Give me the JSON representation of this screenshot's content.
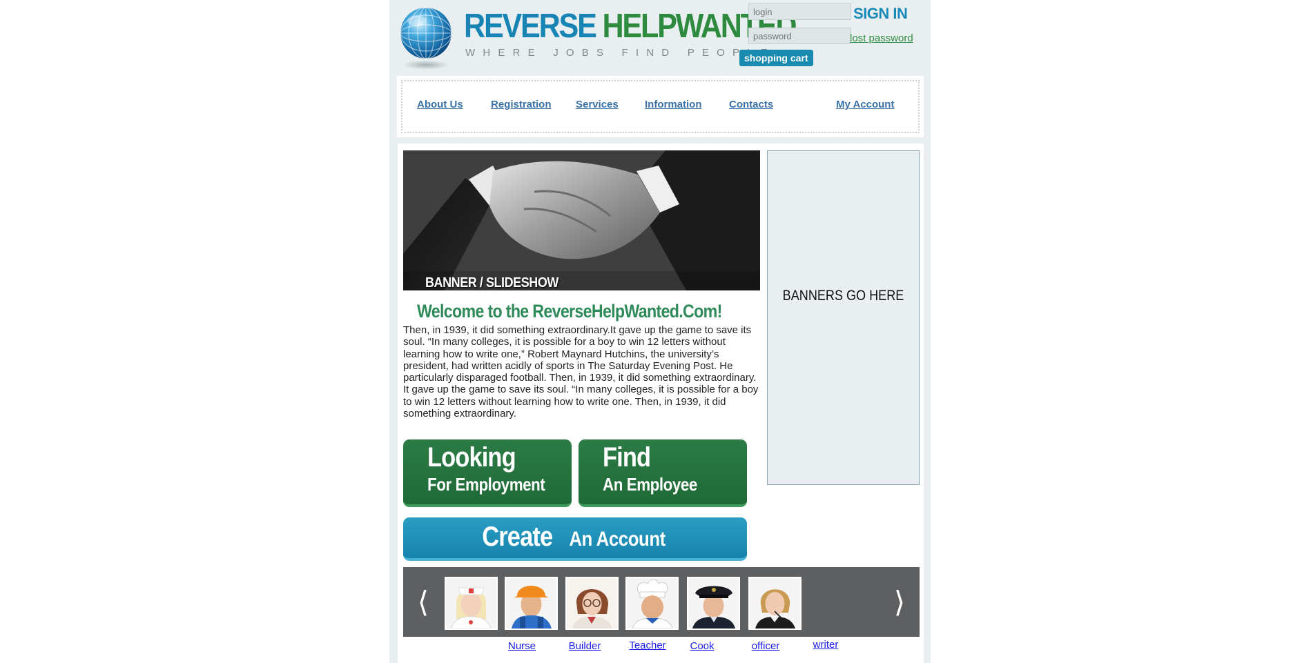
{
  "header": {
    "logo_word1": "REVERSE",
    "logo_word2": "HELPWANTED",
    "tagline": "WHERE JOBS FIND PEOPLE",
    "login_placeholder": "login",
    "password_placeholder": "password",
    "sign_in_label": "SIGN IN",
    "lost_password_label": "lost password",
    "shopping_cart_label": "shopping cart"
  },
  "nav": {
    "items": [
      {
        "label": "About Us"
      },
      {
        "label": "Registration"
      },
      {
        "label": "Services"
      },
      {
        "label": "Information"
      },
      {
        "label": "Contacts"
      },
      {
        "label": "My Account"
      }
    ]
  },
  "hero": {
    "caption": "BANNER / SLIDESHOW"
  },
  "welcome": {
    "title": "Welcome to the ReverseHelpWanted.Com!",
    "body": " Then, in 1939, it did something extraordinary.It gave up the game to save its soul. “In many colleges, it is possible for a boy to win 12 letters without learning how to write one,” Robert Maynard Hutchins, the university’s president, had written acidly of sports in The Saturday Evening Post. He particularly disparaged football. Then, in 1939, it did something extraordinary. It gave up the game to save its soul. “In many colleges, it is possible for a boy to win 12 letters without learning how to write one. Then, in 1939, it did something extraordinary."
  },
  "cta": {
    "looking": {
      "big": "Looking",
      "small": "For Employment"
    },
    "find": {
      "big": "Find",
      "small": "An Employee"
    },
    "create": {
      "big": "Create",
      "small": "An Account"
    }
  },
  "side_banner": {
    "label": "BANNERS GO HERE"
  },
  "carousel": {
    "prev_icon": "chevron-left-icon",
    "next_icon": "chevron-right-icon",
    "items": [
      {
        "label": "Nurse",
        "icon": "nurse-photo"
      },
      {
        "label": "Builder",
        "icon": "builder-photo"
      },
      {
        "label": "Teacher",
        "icon": "teacher-photo"
      },
      {
        "label": "Cook",
        "icon": "cook-photo"
      },
      {
        "label": "officer",
        "icon": "officer-photo"
      },
      {
        "label": "writer",
        "icon": "writer-photo"
      }
    ]
  },
  "colors": {
    "brand_blue": "#1884b3",
    "brand_green": "#2e8a3f",
    "nav_link": "#3a72a6",
    "cta_green": "#1f6a37",
    "cta_blue": "#1583ad",
    "carousel_bg": "#5d5f61"
  }
}
